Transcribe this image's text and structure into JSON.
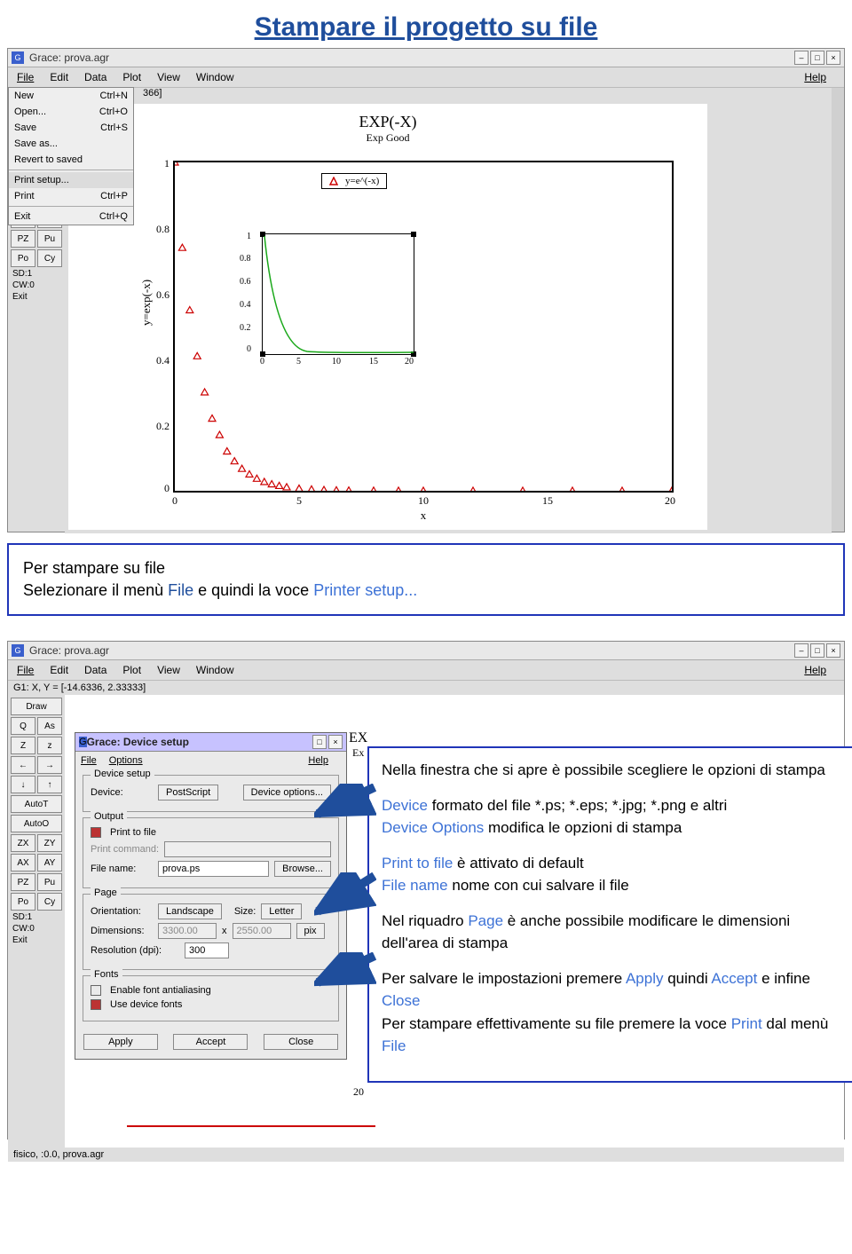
{
  "page_title": "Stampare il progetto su file",
  "app": {
    "title": "Grace: prova.agr",
    "menus": [
      "File",
      "Edit",
      "Data",
      "Plot",
      "View",
      "Window"
    ],
    "help": "Help",
    "coord_status": "G1: X, Y = [-14.6336, 2.33333]",
    "coord_status_trunc": "366]",
    "file_menu": {
      "items": [
        {
          "label": "New",
          "accel": "Ctrl+N"
        },
        {
          "label": "Open...",
          "accel": "Ctrl+O"
        },
        {
          "label": "Save",
          "accel": "Ctrl+S"
        },
        {
          "label": "Save as...",
          "accel": ""
        },
        {
          "label": "Revert to saved",
          "accel": ""
        },
        {
          "sep": true
        },
        {
          "label": "Print setup...",
          "accel": "",
          "sel": true
        },
        {
          "label": "Print",
          "accel": "Ctrl+P"
        },
        {
          "sep": true
        },
        {
          "label": "Exit",
          "accel": "Ctrl+Q"
        }
      ]
    },
    "sidebar1_label_only": "AutoO",
    "sidebar2": {
      "draw": "Draw",
      "row1": [
        "Q",
        "As"
      ],
      "row2": [
        "Z",
        "z"
      ],
      "arrows": [
        "←",
        "→",
        "↓",
        "↑"
      ],
      "autot": "AutoT",
      "autoo": "AutoO",
      "zx": "ZX",
      "zy": "ZY",
      "ax": "AX",
      "ay": "AY",
      "pz": "PZ",
      "pu": "Pu",
      "po": "Po",
      "cy": "Cy",
      "sd": "SD:1",
      "cw": "CW:0",
      "exit": "Exit"
    },
    "status_bottom": "fisico, :0.0, prova.agr"
  },
  "chart_data": {
    "type": "line",
    "title": "EXP(-X)",
    "subtitle": "Exp Good",
    "xlabel": "x",
    "ylabel": "y=exp(-x)",
    "xlim": [
      0,
      20
    ],
    "ylim": [
      0,
      1
    ],
    "xticks": [
      0,
      5,
      10,
      15,
      20
    ],
    "yticks": [
      0,
      0.2,
      0.4,
      0.6,
      0.8,
      1
    ],
    "legend": "y=e^(-x)",
    "series": [
      {
        "name": "y=e^(-x)",
        "marker": "triangle",
        "color": "#cc0000",
        "x": [
          0,
          0.3,
          0.6,
          0.9,
          1.2,
          1.5,
          1.8,
          2.1,
          2.4,
          2.7,
          3.0,
          3.3,
          3.6,
          3.9,
          4.2,
          4.5,
          5,
          5.5,
          6,
          6.5,
          7,
          8,
          9,
          10,
          12,
          14,
          16,
          18,
          20
        ],
        "y": [
          1,
          0.74,
          0.55,
          0.41,
          0.3,
          0.22,
          0.17,
          0.12,
          0.09,
          0.067,
          0.05,
          0.037,
          0.027,
          0.02,
          0.015,
          0.011,
          0.0067,
          0.0041,
          0.0025,
          0.0015,
          0.0009,
          0.0003,
          0.0001,
          0,
          0,
          0,
          0,
          0,
          0
        ]
      }
    ],
    "inset": {
      "xlim": [
        0,
        20
      ],
      "ylim": [
        0,
        1
      ],
      "xticks": [
        0,
        5,
        10,
        15,
        20
      ],
      "yticks": [
        0,
        0.2,
        0.4,
        0.6,
        0.8,
        1
      ],
      "curve_color": "#1aa81a"
    }
  },
  "callout1": {
    "line1": "Per stampare su file",
    "line2a": "Selezionare il menù ",
    "line2b": "File",
    "line2c": " e quindi la voce ",
    "line2d": "Printer setup..."
  },
  "dialog": {
    "title": "Grace: Device setup",
    "menus": {
      "file": "File",
      "options": "Options",
      "help": "Help"
    },
    "device": {
      "legend": "Device setup",
      "label": "Device:",
      "value": "PostScript",
      "opts_btn": "Device options..."
    },
    "output": {
      "legend": "Output",
      "print_to_file": "Print to file",
      "print_cmd_label": "Print command:",
      "filename_label": "File name:",
      "filename_value": "prova.ps",
      "browse": "Browse..."
    },
    "page": {
      "legend": "Page",
      "orient_label": "Orientation:",
      "orient_value": "Landscape",
      "size_label": "Size:",
      "size_value": "Letter",
      "dim_label": "Dimensions:",
      "dim_w": "3300.00",
      "dim_mul": "x",
      "dim_h": "2550.00",
      "dim_unit": "pix",
      "dpi_label": "Resolution (dpi):",
      "dpi": "300"
    },
    "fonts": {
      "legend": "Fonts",
      "aa": "Enable font antialiasing",
      "devfonts": "Use device fonts"
    },
    "btns": {
      "apply": "Apply",
      "accept": "Accept",
      "close": "Close"
    }
  },
  "info2": {
    "p1": "Nella finestra che si apre è possibile scegliere le opzioni di stampa",
    "p2a": "Device",
    "p2b": " formato del file *.ps; *.eps; *.jpg; *.png e altri",
    "p3a": "Device Options",
    "p3b": " modifica le opzioni di stampa",
    "p4a": "Print to file",
    "p4b": " è attivato di default",
    "p5a": "File name",
    "p5b": " nome con cui salvare il file",
    "p6a": "Nel riquadro ",
    "p6b": "Page",
    "p6c": " è anche possibile modificare le dimensioni dell'area di stampa",
    "p7a": "Per salvare le impostazioni premere ",
    "p7b": "Apply",
    "p7c": " quindi ",
    "p7d": "Accept",
    "p7e": " e infine ",
    "p7f": "Close",
    "p8a": "Per stampare effettivamente su file premere la voce ",
    "p8b": "Print",
    "p8c": " dal menù ",
    "p8d": "File"
  },
  "ex_label_stub": {
    "l1": "EX",
    "l2": "Ex"
  }
}
